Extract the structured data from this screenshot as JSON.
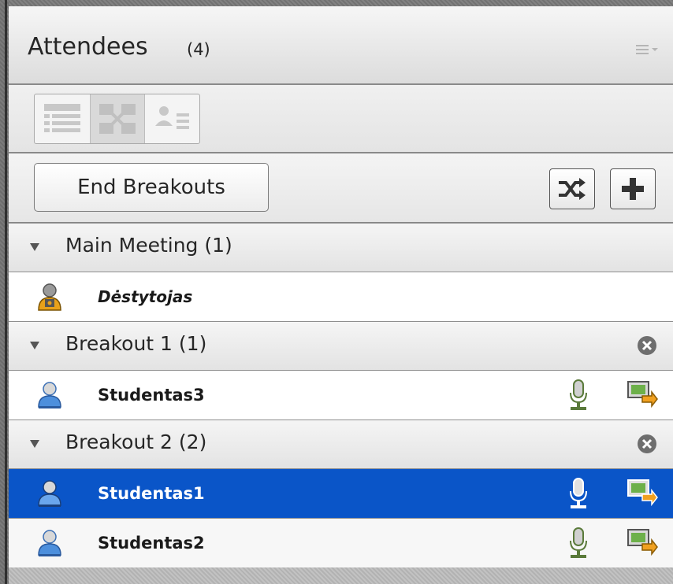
{
  "panel": {
    "title": "Attendees",
    "count": "(4)"
  },
  "view_modes": [
    "list-view-icon",
    "breakout-view-icon",
    "attendee-status-view-icon"
  ],
  "toolbar": {
    "end_breakouts_label": "End Breakouts",
    "shuffle_icon": "shuffle-icon",
    "add_icon": "plus-icon"
  },
  "groups": [
    {
      "label": "Main Meeting (1)",
      "closable": false,
      "users": [
        {
          "name": "Dėstytojas",
          "role": "host",
          "selected": false
        }
      ]
    },
    {
      "label": "Breakout 1 (1)",
      "closable": true,
      "users": [
        {
          "name": "Studentas3",
          "role": "participant",
          "selected": false
        }
      ]
    },
    {
      "label": "Breakout 2 (2)",
      "closable": true,
      "users": [
        {
          "name": "Studentas1",
          "role": "participant",
          "selected": true
        },
        {
          "name": "Studentas2",
          "role": "participant",
          "selected": false
        }
      ]
    }
  ],
  "colors": {
    "selection": "#0a55c8",
    "host_icon": "#e8a11a",
    "participant_icon": "#4d8fdc"
  }
}
